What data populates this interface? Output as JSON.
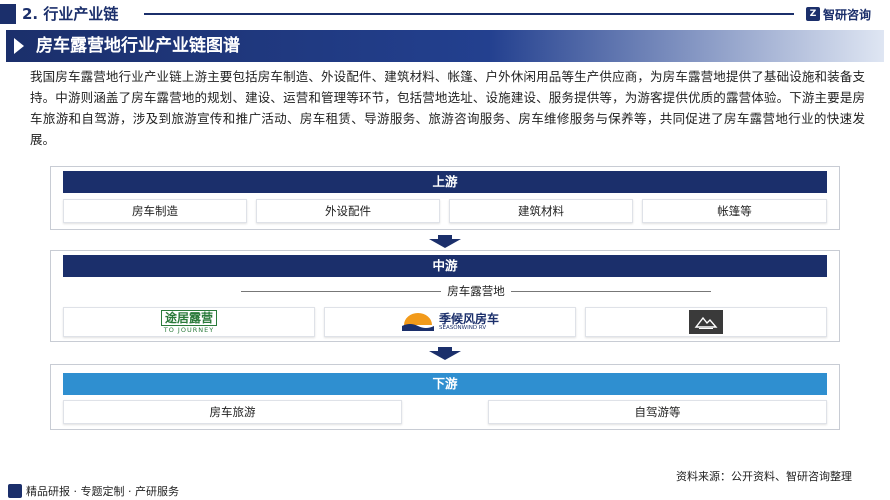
{
  "header": {
    "section_title": "2. 行业产业链",
    "brand": "智研咨询",
    "brand_mark": "Z"
  },
  "heading": {
    "title": "房车露营地行业产业链图谱"
  },
  "intro": "我国房车露营地行业产业链上游主要包括房车制造、外设配件、建筑材料、帐篷、户外休闲用品等生产供应商，为房车露营地提供了基础设施和装备支持。中游则涵盖了房车露营地的规划、建设、运营和管理等环节，包括营地选址、设施建设、服务提供等，为游客提供优质的露营体验。下游主要是房车旅游和自驾游，涉及到旅游宣传和推广活动、房车租赁、导游服务、旅游咨询服务、房车维修服务与保养等，共同促进了房车露营地行业的快速发展。",
  "upstream": {
    "label": "上游",
    "items": [
      "房车制造",
      "外设配件",
      "建筑材料",
      "帐篷等"
    ]
  },
  "midstream": {
    "label": "中游",
    "sublabel": "房车露营地",
    "logos": [
      {
        "main": "途居露营",
        "sub": "TO JOURNEY",
        "icon": "to-journey-logo"
      },
      {
        "main": "季候风房车",
        "sub": "SEASONWIND  RV",
        "icon": "seasonwind-logo"
      },
      {
        "main": "",
        "sub": "",
        "icon": "camp-mountain-logo"
      }
    ]
  },
  "downstream": {
    "label": "下游",
    "items": [
      "房车旅游",
      "自驾游等"
    ]
  },
  "footer": {
    "left": "精品研报 · 专题定制 · 产研服务",
    "source": "资料来源：公开资料、智研咨询整理"
  },
  "colors": {
    "primary": "#1b2f6b",
    "accent": "#2f8fd0"
  }
}
